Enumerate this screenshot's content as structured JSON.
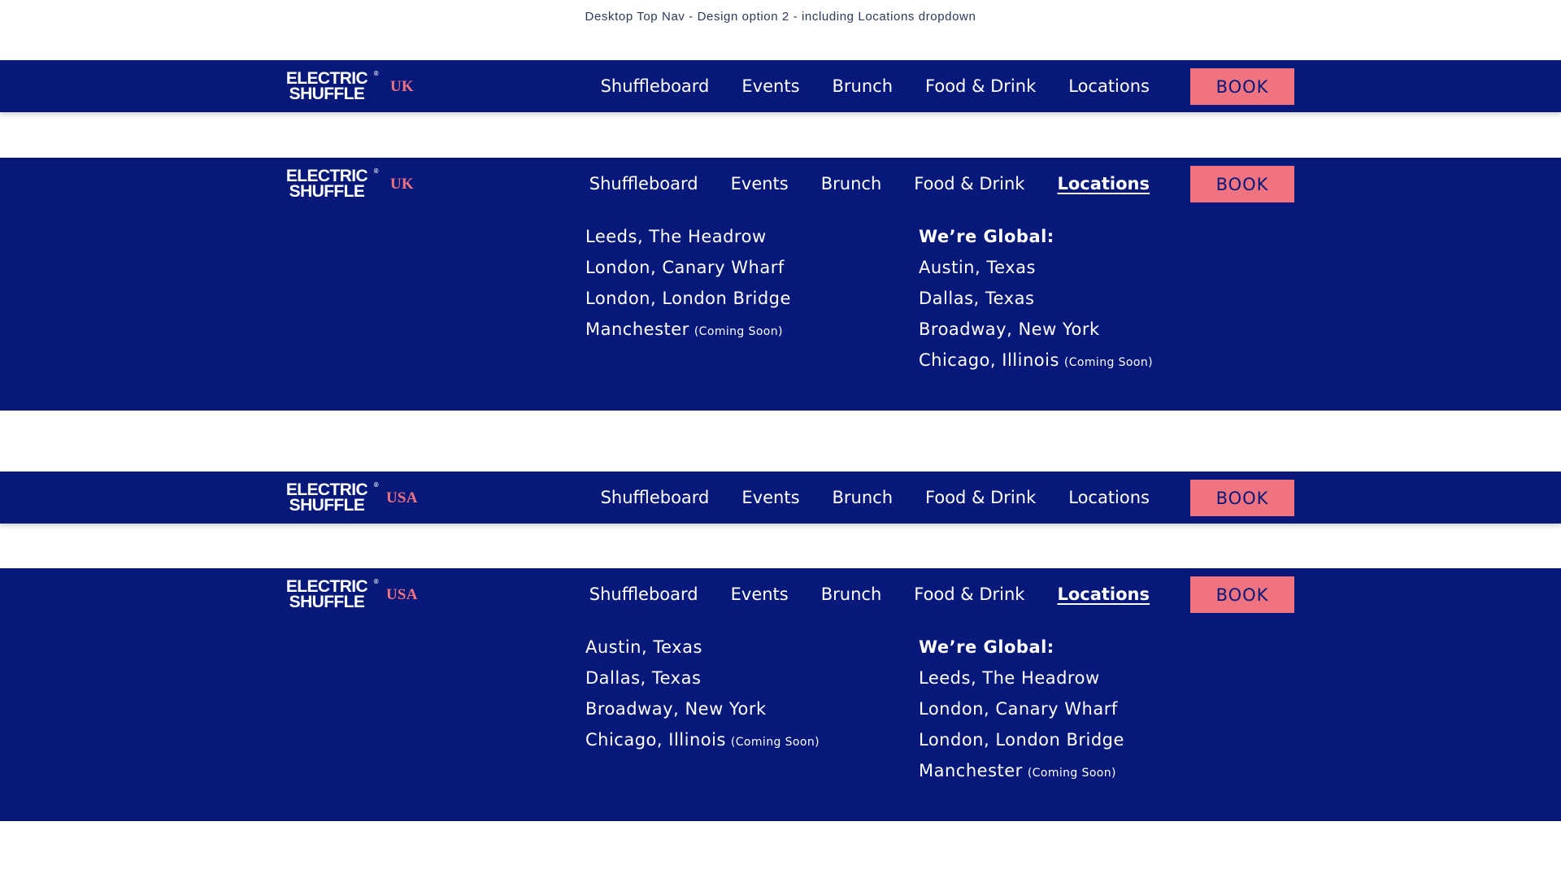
{
  "caption": "Desktop Top Nav - Design option 2 - including Locations dropdown",
  "colors": {
    "navy": "#06187a",
    "accent": "#f07380",
    "white": "#ffffff"
  },
  "logo": {
    "line1": "ELECTRIC",
    "line2": "SHUFFLE",
    "registered": "®"
  },
  "regions": {
    "uk": "UK",
    "usa": "USA"
  },
  "menu": {
    "shuffleboard": "Shuffleboard",
    "events": "Events",
    "brunch": "Brunch",
    "food_drink": "Food & Drink",
    "locations": "Locations"
  },
  "book_label": "BOOK",
  "coming_soon": "(Coming Soon)",
  "global_heading": "We’re Global:",
  "uk_locations": {
    "leeds": "Leeds, The Headrow",
    "canary": "London, Canary Wharf",
    "bridge": "London, London Bridge",
    "manchester": "Manchester"
  },
  "us_locations": {
    "austin": "Austin, Texas",
    "dallas": "Dallas, Texas",
    "broadway": "Broadway, New York",
    "chicago": "Chicago, Illinois"
  }
}
